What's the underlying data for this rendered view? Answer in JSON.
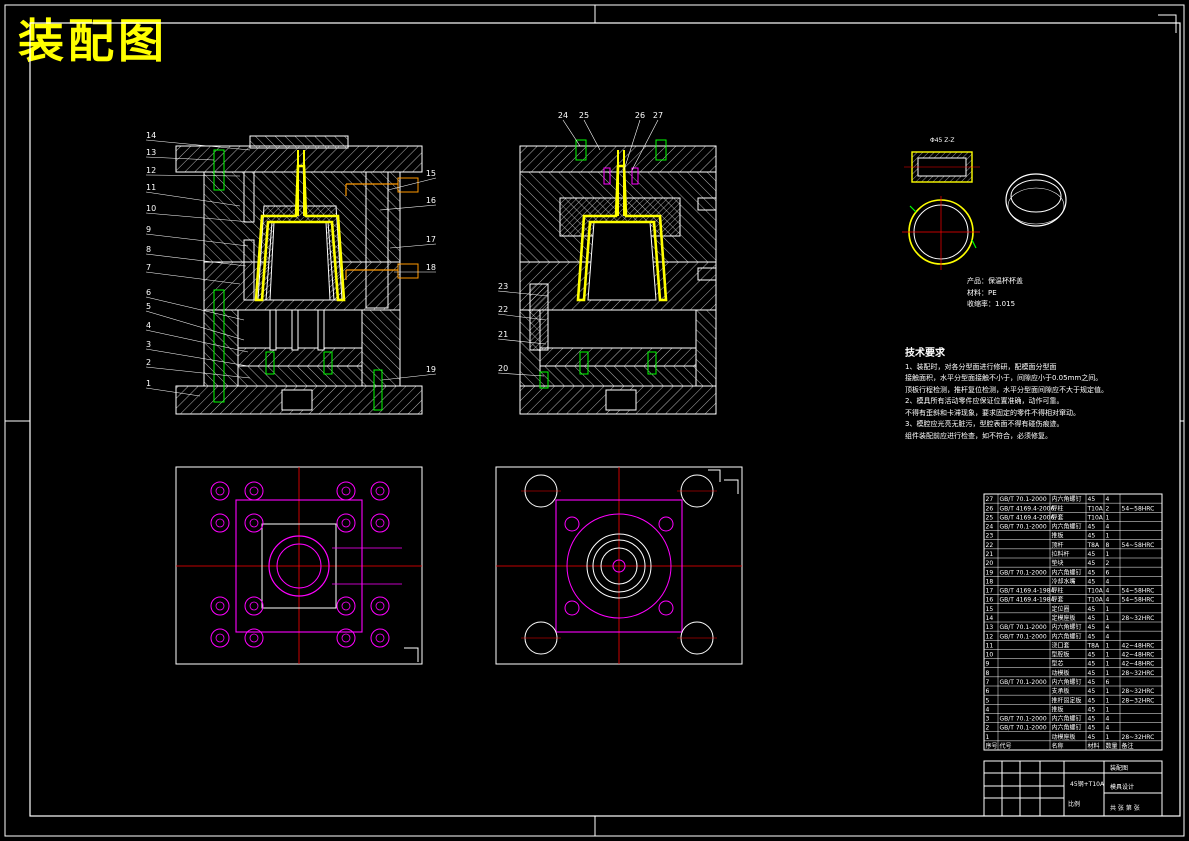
{
  "drawing_title": "装配图",
  "section_label": "Φ45 Z-Z",
  "product": {
    "name_line": "产品：保温杯杯盖",
    "material_line": "材料：PE",
    "shrink_line": "收缩率：1.015"
  },
  "tech_requirements": {
    "heading": "技术要求",
    "lines": [
      "1、装配时，对各分型面进行修研，配模面分型面",
      "接触面积，水平分型面接触不小于，间隙应小于0.05mm之间。",
      "顶板行程检测，推杆复位检测，水平分型面间隙应不大于规定值。",
      "2、模具所有活动零件应保证位置准确，动作可靠。",
      "不得有歪斜和卡滞现象，要求固定的零件不得相对窜动。",
      "3、模腔应光亮无脏污，型腔表面不得有碰伤痕迹。",
      "组件装配前应进行检查，如不符合，必须修复。"
    ]
  },
  "part_labels_left": [
    "14",
    "13",
    "12",
    "11",
    "10",
    "9",
    "8",
    "7",
    "6",
    "5",
    "4",
    "3",
    "2",
    "1"
  ],
  "part_labels_right": [
    "15",
    "16",
    "17",
    "18",
    "19"
  ],
  "part_labels_top": [
    "24",
    "25",
    "26",
    "27"
  ],
  "part_labels_side": [
    "23",
    "22",
    "21",
    "20"
  ],
  "bom_rows": [
    {
      "no": "27",
      "std": "GB/T 70.1-2000",
      "name": "内六角螺钉",
      "qty": "4",
      "mat": "45",
      "note": ""
    },
    {
      "no": "26",
      "std": "GB/T 4169.4-2006",
      "name": "导柱",
      "qty": "2",
      "mat": "T10A",
      "note": "54~58HRC"
    },
    {
      "no": "25",
      "std": "GB/T 4169.4-2006",
      "name": "导套",
      "qty": "1",
      "mat": "T10A",
      "note": ""
    },
    {
      "no": "24",
      "std": "GB/T 70.1-2000",
      "name": "内六角螺钉",
      "qty": "4",
      "mat": "45",
      "note": ""
    },
    {
      "no": "23",
      "std": "",
      "name": "推板",
      "qty": "1",
      "mat": "45",
      "note": ""
    },
    {
      "no": "22",
      "std": "",
      "name": "顶杆",
      "qty": "8",
      "mat": "T8A",
      "note": "54~58HRC"
    },
    {
      "no": "21",
      "std": "",
      "name": "拉料杆",
      "qty": "1",
      "mat": "45",
      "note": ""
    },
    {
      "no": "20",
      "std": "",
      "name": "垫块",
      "qty": "2",
      "mat": "45",
      "note": ""
    },
    {
      "no": "19",
      "std": "GB/T 70.1-2000",
      "name": "内六角螺钉",
      "qty": "6",
      "mat": "45",
      "note": ""
    },
    {
      "no": "18",
      "std": "",
      "name": "冷却水嘴",
      "qty": "4",
      "mat": "45",
      "note": ""
    },
    {
      "no": "17",
      "std": "GB/T 4169.4-1984",
      "name": "导柱",
      "qty": "4",
      "mat": "T10A",
      "note": "54~58HRC"
    },
    {
      "no": "16",
      "std": "GB/T 4169.4-1984",
      "name": "导套",
      "qty": "4",
      "mat": "T10A",
      "note": "54~58HRC"
    },
    {
      "no": "15",
      "std": "",
      "name": "定位圈",
      "qty": "1",
      "mat": "45",
      "note": ""
    },
    {
      "no": "14",
      "std": "",
      "name": "定模座板",
      "qty": "1",
      "mat": "45",
      "note": "28~32HRC"
    },
    {
      "no": "13",
      "std": "GB/T 70.1-2000",
      "name": "内六角螺钉",
      "qty": "4",
      "mat": "45",
      "note": ""
    },
    {
      "no": "12",
      "std": "GB/T 70.1-2000",
      "name": "内六角螺钉",
      "qty": "4",
      "mat": "45",
      "note": ""
    },
    {
      "no": "11",
      "std": "",
      "name": "浇口套",
      "qty": "1",
      "mat": "T8A",
      "note": "42~48HRC"
    },
    {
      "no": "10",
      "std": "",
      "name": "型腔板",
      "qty": "1",
      "mat": "45",
      "note": "42~48HRC"
    },
    {
      "no": "9",
      "std": "",
      "name": "型芯",
      "qty": "1",
      "mat": "45",
      "note": "42~48HRC"
    },
    {
      "no": "8",
      "std": "",
      "name": "动模板",
      "qty": "1",
      "mat": "45",
      "note": "28~32HRC"
    },
    {
      "no": "7",
      "std": "GB/T 70.1-2000",
      "name": "内六角螺钉",
      "qty": "6",
      "mat": "45",
      "note": ""
    },
    {
      "no": "6",
      "std": "",
      "name": "支承板",
      "qty": "1",
      "mat": "45",
      "note": "28~32HRC"
    },
    {
      "no": "5",
      "std": "",
      "name": "推杆固定板",
      "qty": "1",
      "mat": "45",
      "note": "28~32HRC"
    },
    {
      "no": "4",
      "std": "",
      "name": "推板",
      "qty": "1",
      "mat": "45",
      "note": ""
    },
    {
      "no": "3",
      "std": "GB/T 70.1-2000",
      "name": "内六角螺钉",
      "qty": "4",
      "mat": "45",
      "note": ""
    },
    {
      "no": "2",
      "std": "GB/T 70.1-2000",
      "name": "内六角螺钉",
      "qty": "4",
      "mat": "45",
      "note": ""
    },
    {
      "no": "1",
      "std": "",
      "name": "动模座板",
      "qty": "1",
      "mat": "45",
      "note": "28~32HRC"
    }
  ],
  "bom_header": {
    "no": "序号",
    "std": "代号",
    "name": "名称",
    "qty": "数量",
    "mat": "材料",
    "note": "备注"
  },
  "title_block": {
    "material_cell": "45钢+T10A",
    "drawing_name": "装配图",
    "company": "模具设计",
    "scale_label": "比例",
    "sheet_label": "共 张 第 张"
  },
  "colors": {
    "yellow": "#ffff00",
    "green": "#00ff00",
    "magenta": "#ff00ff",
    "red": "#ff0000",
    "orange": "#ff9900",
    "white": "#ffffff"
  }
}
